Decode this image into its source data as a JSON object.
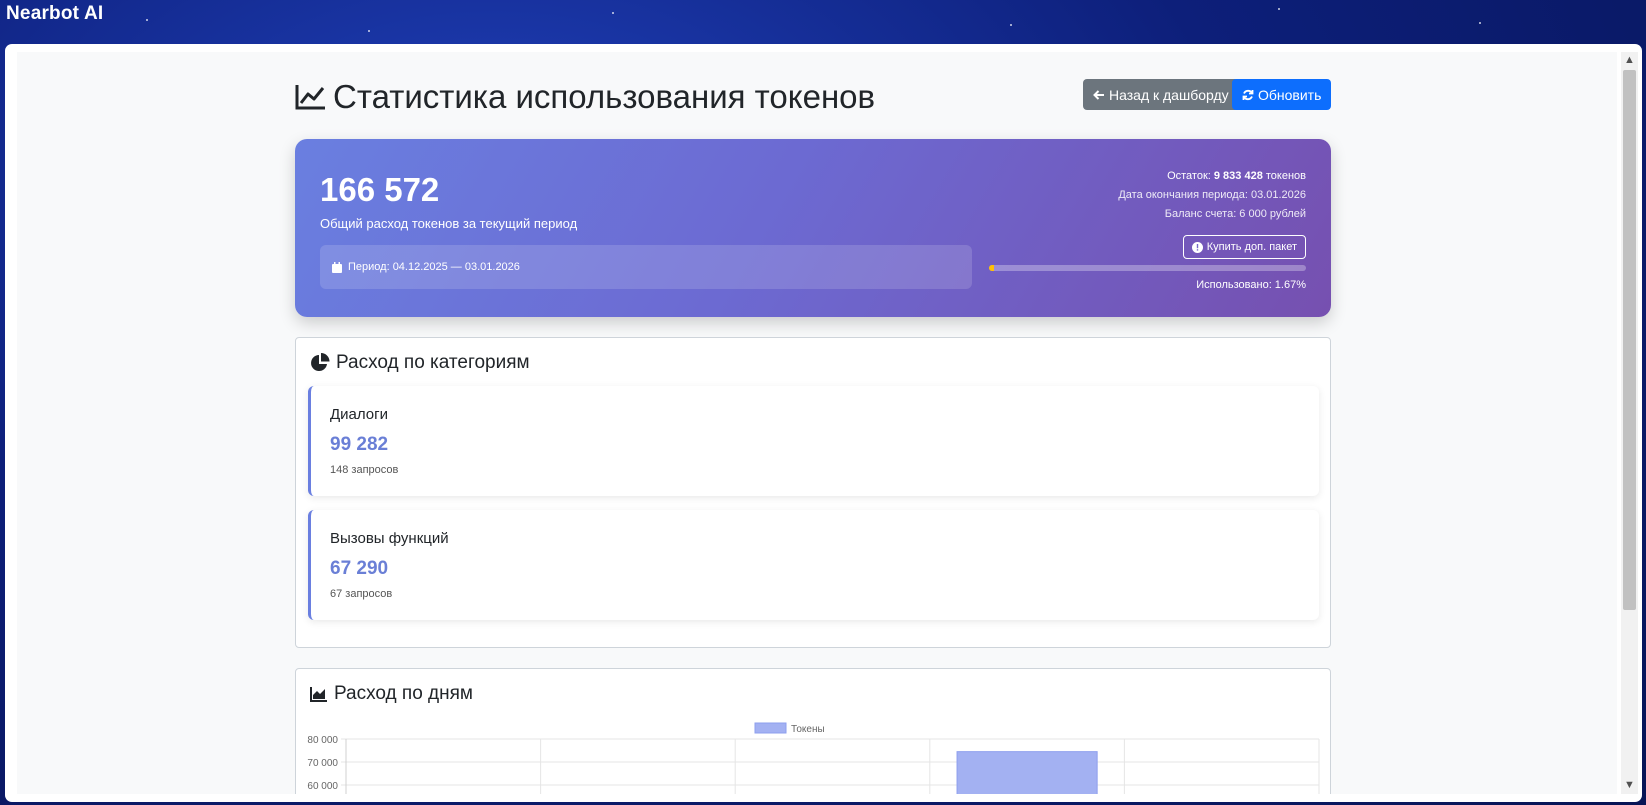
{
  "brand": "Nearbot AI",
  "header": {
    "title": "Статистика использования токенов",
    "back_label": "Назад к дашборду",
    "refresh_label": "Обновить"
  },
  "summary": {
    "total": "166 572",
    "total_desc": "Общий расход токенов за текущий период",
    "period_label": "Период: 04.12.2025 — 03.01.2026",
    "remaining_prefix": "Остаток:",
    "remaining_value": "9 833 428",
    "remaining_suffix": "токенов",
    "period_end": "Дата окончания периода: 03.01.2026",
    "balance": "Баланс счета: 6 000 рублей",
    "buy_label": "Купить доп. пакет",
    "used_label": "Использовано: 1.67%",
    "used_fraction": 0.0167
  },
  "categories": {
    "title": "Расход по категориям",
    "items": [
      {
        "name": "Диалоги",
        "value": "99 282",
        "requests": "148 запросов"
      },
      {
        "name": "Вызовы функций",
        "value": "67 290",
        "requests": "67 запросов"
      }
    ]
  },
  "daily": {
    "title": "Расход по дням"
  },
  "chart_data": {
    "type": "bar",
    "legend": [
      "Токены"
    ],
    "legend_position": "top-center",
    "series": [
      {
        "name": "Токены",
        "values": [
          0,
          0,
          0,
          74500,
          0
        ]
      }
    ],
    "categories": [
      "",
      "",
      "",
      "",
      ""
    ],
    "yticks": [
      60000,
      70000,
      80000
    ],
    "ytick_labels": [
      "60 000",
      "70 000",
      "80 000"
    ],
    "ylim": [
      0,
      80000
    ],
    "grid": true,
    "colors": {
      "bar": "#a3b1f2",
      "bar_border": "#8e9fee"
    }
  },
  "colors": {
    "accent": "#6a7fe0",
    "primary": "#0d6efd",
    "secondary": "#6c757d",
    "progress": "#ffc107"
  }
}
